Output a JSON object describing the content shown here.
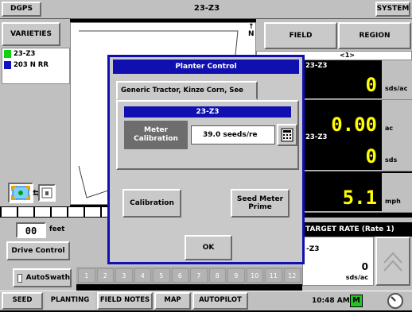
{
  "topbar": {
    "dgps_label": "DGPS",
    "field_title": "23-Z3",
    "system_label": "SYSTEM"
  },
  "left": {
    "varieties_label": "VARIETIES",
    "legend": [
      {
        "label": "23-Z3",
        "color": "#10d010"
      },
      {
        "label": "203 N RR",
        "color": "#1010c0"
      }
    ],
    "north_label": "N",
    "lightbar": {
      "offset": "00",
      "unit": "feet"
    },
    "drive_control_label": "Drive Control",
    "autoswath_label": "AutoSwath"
  },
  "right": {
    "field_label": "FIELD",
    "region_label": "REGION",
    "field_row_value": "<1>",
    "readouts": [
      {
        "header": "23-Z3",
        "value": "0",
        "unit": "sds/ac"
      },
      {
        "header": "",
        "value": "0.00",
        "unit": "ac"
      },
      {
        "header": "23-Z3",
        "value": "0",
        "unit": "sds"
      },
      {
        "header": "",
        "value": "5.1",
        "unit": "mph"
      }
    ],
    "target_rate": {
      "header": "TARGET RATE (Rate 1)",
      "product": "-Z3",
      "value": "0",
      "unit": "sds/ac"
    }
  },
  "rows": [
    "1",
    "2",
    "3",
    "4",
    "5",
    "6",
    "7",
    "8",
    "9",
    "10",
    "11",
    "12"
  ],
  "dialog": {
    "title": "Planter Control",
    "tab_label": "Generic Tractor, Kinze Corn, See",
    "product": "23-Z3",
    "meter_label": "Meter Calibration",
    "meter_value": "39.0  seeds/re",
    "calibration_label": "Calibration",
    "seed_meter_prime_label": "Seed Meter Prime",
    "ok_label": "OK"
  },
  "tabs": [
    {
      "label": "SEED"
    },
    {
      "label": "PLANTING"
    },
    {
      "label": "FIELD NOTES"
    },
    {
      "label": "MAP"
    },
    {
      "label": "AUTOPILOT"
    }
  ],
  "status": {
    "clock": "10:48 AM",
    "mode_badge": "M"
  },
  "colors": {
    "dialog_blue": "#1010b0",
    "lcd_yellow": "#ffff00",
    "badge_green": "#22c422"
  }
}
